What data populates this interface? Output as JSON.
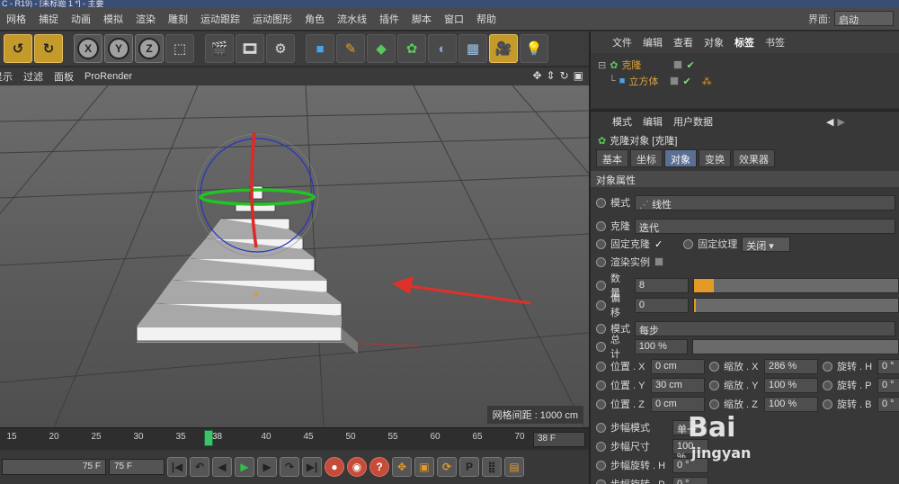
{
  "title_bar": "C - R19) - [未标题 1 *] - 主要",
  "menu": [
    "网格",
    "捕捉",
    "动画",
    "模拟",
    "渲染",
    "雕刻",
    "运动跟踪",
    "运动图形",
    "角色",
    "流水线",
    "插件",
    "脚本",
    "窗口",
    "帮助"
  ],
  "interface": {
    "label": "界面:",
    "value": "启动"
  },
  "toolbar_icons": [
    "undo-icon",
    "redo-icon",
    "x-axis-icon",
    "y-axis-icon",
    "z-axis-icon",
    "coordinate-system-icon",
    "render-view-icon",
    "render-picture-viewer-icon",
    "edit-render-settings-icon",
    "cube-icon",
    "pen-icon",
    "subdivision-icon",
    "cloner-icon",
    "deformer-icon",
    "floor-icon",
    "camera-icon",
    "light-icon"
  ],
  "viewport_menu": [
    "显示",
    "过滤",
    "面板",
    "ProRender"
  ],
  "viewport_status": "网格间距 : 1000 cm",
  "timeline": {
    "ticks": [
      "15",
      "20",
      "25",
      "30",
      "35",
      "38",
      "40",
      "45",
      "50",
      "55",
      "60",
      "65",
      "70",
      "75"
    ],
    "current": "38",
    "end": "38 F"
  },
  "transport": {
    "frame_left": "75 F",
    "frame_right": "75 F"
  },
  "object_manager": {
    "menu": [
      "文件",
      "编辑",
      "查看",
      "对象",
      "标签",
      "书签"
    ],
    "objects": [
      {
        "name": "克隆",
        "level": 0
      },
      {
        "name": "立方体",
        "level": 1
      }
    ]
  },
  "attribute_manager": {
    "menu": [
      "模式",
      "编辑",
      "用户数据"
    ],
    "title": "克隆对象 [克隆]",
    "tabs": [
      "基本",
      "坐标",
      "对象",
      "变换",
      "效果器"
    ],
    "active_tab": "对象",
    "section": "对象属性",
    "mode": {
      "label": "模式",
      "value": "线性"
    },
    "clones": {
      "label": "克隆",
      "value": "迭代"
    },
    "fix_clone": {
      "label": "固定克隆",
      "checked": true
    },
    "fix_texture": {
      "label": "固定纹理",
      "value": "关闭"
    },
    "render_instances": {
      "label": "渲染实例"
    },
    "count": {
      "label": "数量",
      "value": "8",
      "fraction": 0.1
    },
    "offset": {
      "label": "偏移",
      "value": "0",
      "fraction": 0.0
    },
    "step_mode": {
      "label": "模式",
      "value": "每步"
    },
    "total": {
      "label": "总计",
      "value": "100 %"
    },
    "position": [
      {
        "label": "位置 . X",
        "value": "0 cm"
      },
      {
        "label": "位置 . Y",
        "value": "30 cm"
      },
      {
        "label": "位置 . Z",
        "value": "0 cm"
      }
    ],
    "scale": [
      {
        "label": "缩放 . X",
        "value": "286 %"
      },
      {
        "label": "缩放 . Y",
        "value": "100 %"
      },
      {
        "label": "缩放 . Z",
        "value": "100 %"
      }
    ],
    "rotation": [
      {
        "label": "旋转 . H",
        "value": "0 °"
      },
      {
        "label": "旋转 . P",
        "value": "0 °"
      },
      {
        "label": "旋转 . B",
        "value": "0 °"
      }
    ],
    "step": [
      {
        "label": "步幅模式",
        "value": "单一"
      },
      {
        "label": "步幅尺寸",
        "value": "100 %"
      },
      {
        "label": "步幅旋转 . H",
        "value": "0 °"
      },
      {
        "label": "步幅旋转 . P",
        "value": "0 °"
      }
    ]
  },
  "watermark": {
    "main": "Bai",
    "sub": "jingyan"
  },
  "colors": {
    "accent": "#e39a29",
    "active_tab": "#5a6f93",
    "timeline_marker": "#3ec26a",
    "arrow": "#e0302a"
  }
}
